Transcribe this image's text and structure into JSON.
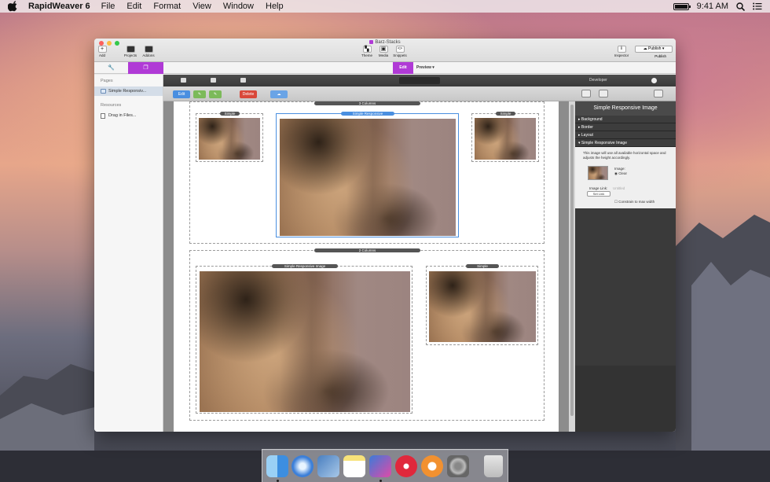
{
  "menubar": {
    "app_name": "RapidWeaver 6",
    "menus": [
      "File",
      "Edit",
      "Format",
      "View",
      "Window",
      "Help"
    ],
    "clock": "9:41 AM"
  },
  "window": {
    "title": "Barz-Stacks",
    "toolbar": {
      "add": "Add",
      "projects": "Projects",
      "addons": "Addons",
      "themes": "Theme",
      "media": "Media",
      "snippets": "Snippets",
      "inspector": "Inspector",
      "publish_btn": "Publish",
      "publish_lbl": "Publish"
    },
    "mode_tabs": {
      "edit": "Edit",
      "preview": "Preview"
    }
  },
  "sidebar": {
    "pages_heading": "Pages",
    "page_item": "Simple Responsiv...",
    "resources_heading": "Resources",
    "resource_item": "Drag in Files..."
  },
  "stacks_toolbar": {
    "edit": "Edit",
    "delete": "Delete"
  },
  "canvas": {
    "stack_3col": "3 Columns",
    "stack_2col": "2 Columns",
    "labels": {
      "simple_a": "Simple",
      "simple_responsive": "Simple Responsive",
      "simple_b": "Simple",
      "simple_responsive_image": "Simple Responsive Image",
      "simple_c": "Simple"
    }
  },
  "inspector": {
    "top_label": "Developer",
    "title": "Simple Responsive Image",
    "sections": [
      "Background",
      "Border",
      "Layout",
      "Simple Responsive Image"
    ],
    "description": "This image will use all available horizontal space and adjusts the height accordingly.",
    "image_label": "Image:",
    "clear_label": "Clear",
    "image_link_label": "Image Link:",
    "image_link_value": "Untitled",
    "set_link_button": "Set Link",
    "constrain_label": "Constrain to max width"
  },
  "colors": {
    "accent": "#b03ad6",
    "selected_label": "#4a8fe0",
    "edit_button": "#4a8fe0",
    "delete_button": "#d9483a"
  }
}
